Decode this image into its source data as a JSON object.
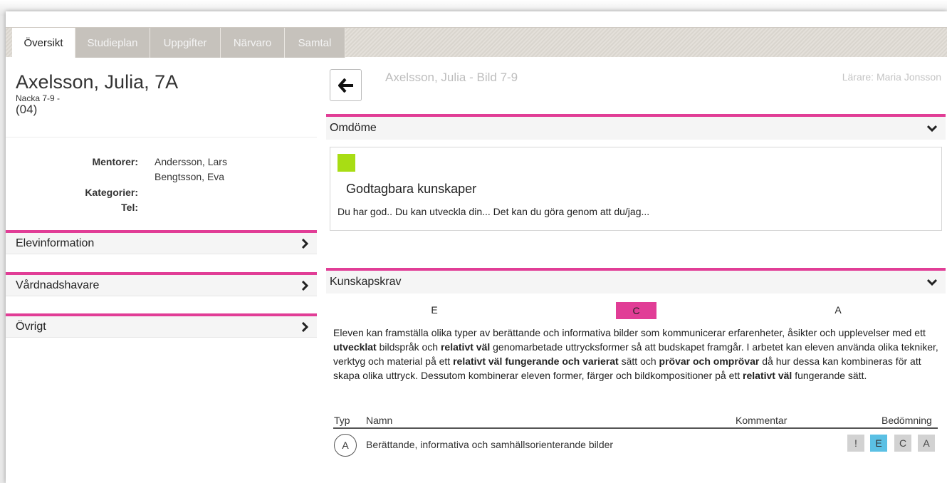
{
  "tabs": [
    {
      "label": "Översikt",
      "active": true
    },
    {
      "label": "Studieplan",
      "active": false
    },
    {
      "label": "Uppgifter",
      "active": false
    },
    {
      "label": "Närvaro",
      "active": false
    },
    {
      "label": "Samtal",
      "active": false
    }
  ],
  "student": {
    "name": "Axelsson, Julia, 7A",
    "school": "Nacka 7-9 -",
    "number": "(04)"
  },
  "info": {
    "mentors_label": "Mentorer:",
    "mentors": [
      "Andersson, Lars",
      "Bengtsson, Eva"
    ],
    "categories_label": "Kategorier:",
    "tel_label": "Tel:"
  },
  "left_panels": [
    "Elevinformation",
    "Vårdnadshavare",
    "Övrigt"
  ],
  "header": {
    "title": "Axelsson, Julia - Bild 7-9",
    "teacher": "Lärare: Maria Jonsson"
  },
  "omdome": {
    "heading": "Omdöme",
    "title": "Godtagbara kunskaper",
    "text": "Du har god.. Du kan utveckla din... Det kan du göra genom att du/jag...",
    "color": "#a8dd14"
  },
  "kunskapskrav": {
    "heading": "Kunskapskrav",
    "grades": [
      "E",
      "C",
      "A"
    ],
    "selected_grade": "C",
    "text_parts": [
      {
        "t": "Eleven kan framställa olika typer av berättande och informativa bilder som kommunicerar erfarenheter, åsikter och upplevelser med ett ",
        "b": false
      },
      {
        "t": "utvecklat",
        "b": true
      },
      {
        "t": " bildspråk och ",
        "b": false
      },
      {
        "t": "relativt väl",
        "b": true
      },
      {
        "t": " genomarbetade uttrycksformer så att budskapet framgår. I arbetet kan eleven använda olika tekniker, verktyg och material på ett ",
        "b": false
      },
      {
        "t": "relativt väl fungerande och varierat",
        "b": true
      },
      {
        "t": " sätt och ",
        "b": false
      },
      {
        "t": "prövar och omprövar",
        "b": true
      },
      {
        "t": " då hur dessa kan kombineras för att skapa olika uttryck. Dessutom kombinerar eleven former, färger och bildkompositioner på ett ",
        "b": false
      },
      {
        "t": "relativt väl",
        "b": true
      },
      {
        "t": " fungerande sätt.",
        "b": false
      }
    ],
    "table": {
      "col_typ": "Typ",
      "col_namn": "Namn",
      "col_kommentar": "Kommentar",
      "col_bedomning": "Bedömning",
      "rows": [
        {
          "typ": "A",
          "namn": "Berättande, informativa och samhällsorienterande bilder",
          "buttons": [
            "!",
            "E",
            "C",
            "A"
          ],
          "selected": "E"
        }
      ]
    }
  },
  "colors": {
    "accent": "#e13d96",
    "selected_grade": "#5bc0e4",
    "omdome_square": "#a8dd14"
  }
}
